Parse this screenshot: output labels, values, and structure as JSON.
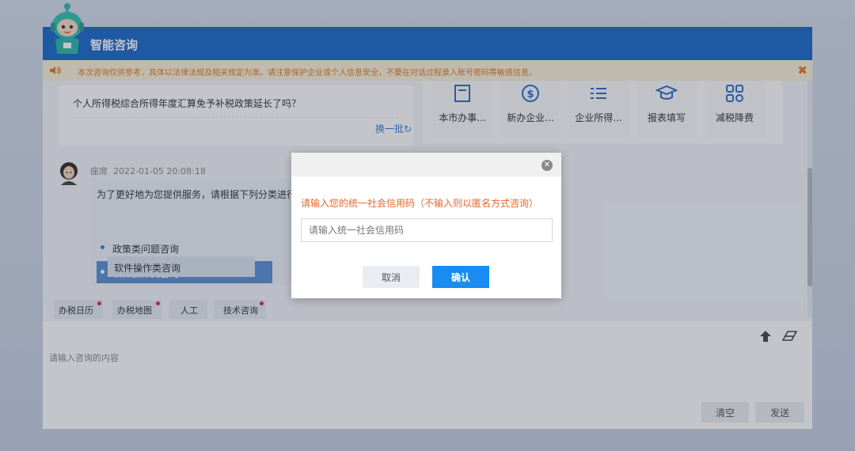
{
  "window": {
    "title": "智能咨询",
    "notice": "本次咨询仅供参考，具体以法律法规及相关规定为准。请注意保护企业或个人信息安全，不要在对话过程录入账号密码等敏感信息。",
    "notice_close": "✖"
  },
  "hot_question": {
    "text": "个人所得税综合所得年度汇算免予补税政策延长了吗？",
    "refresh_label": "换一批",
    "refresh_icon": "↻"
  },
  "shortcuts": [
    {
      "label": "本市办事...",
      "icon": "document-icon"
    },
    {
      "label": "新办企业...",
      "icon": "dollar-icon"
    },
    {
      "label": "企业所得...",
      "icon": "list-icon"
    },
    {
      "label": "报表填写",
      "icon": "graduation-cap-icon"
    },
    {
      "label": "减税降费",
      "icon": "grid-icon"
    }
  ],
  "chat": {
    "bot_name": "座席",
    "timestamp": "2022-01-05 20:08:18",
    "bot_message": "为了更好地为您提供服务，请根据下列分类进行",
    "options": [
      {
        "label": "政策类问题咨询",
        "active": false
      },
      {
        "label": "软件操作类咨询",
        "active": true
      }
    ],
    "sub_option": "软件操作类咨询"
  },
  "quick_tags": [
    {
      "label": "办税日历",
      "has_dot": true
    },
    {
      "label": "办税地图",
      "has_dot": true
    },
    {
      "label": "人工",
      "has_dot": false
    },
    {
      "label": "技术咨询",
      "has_dot": true
    }
  ],
  "input": {
    "placeholder": "请输入咨询的内容",
    "clear_label": "清空",
    "send_label": "发送"
  },
  "dialog": {
    "close_icon": "✕",
    "tip": "请输入您的统一社会信用码（不输入则以匿名方式咨询）",
    "input_placeholder": "请输入统一社会信用码",
    "cancel_label": "取消",
    "confirm_label": "确认"
  },
  "colors": {
    "header": "#1c69c9",
    "notice_text": "#e07a2b",
    "accent": "#1a8bf0",
    "dialog_tip": "#e8662c",
    "tag_dot": "#e0283a"
  }
}
